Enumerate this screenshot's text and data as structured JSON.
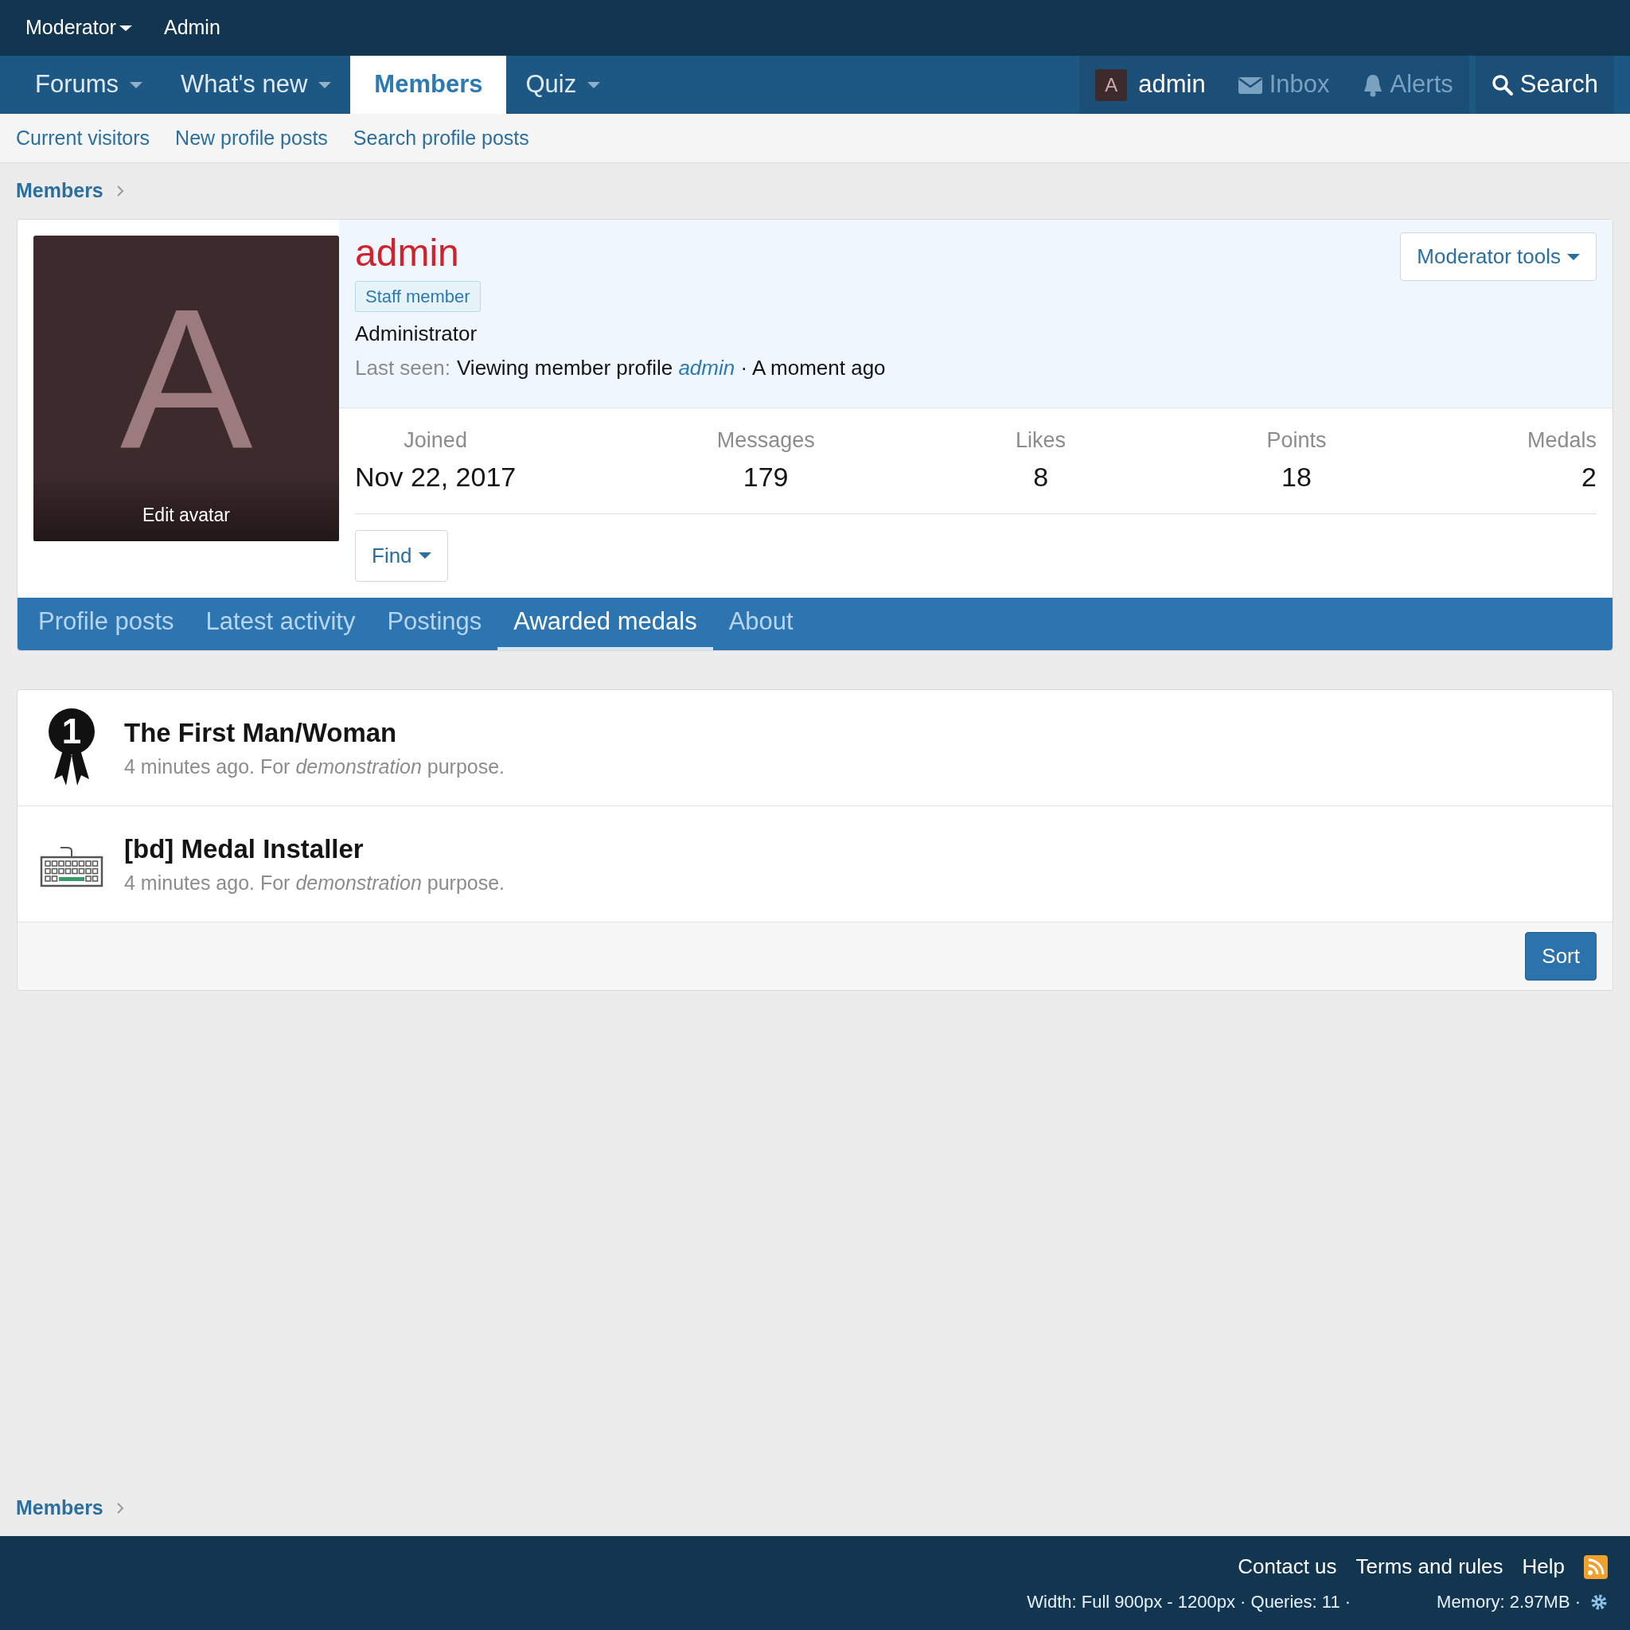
{
  "staff_bar": [
    {
      "label": "Moderator",
      "dropdown": true
    },
    {
      "label": "Admin",
      "dropdown": false
    }
  ],
  "nav_tabs": [
    {
      "label": "Forums",
      "selected": false,
      "dropdown": true
    },
    {
      "label": "What's new",
      "selected": false,
      "dropdown": true
    },
    {
      "label": "Members",
      "selected": true,
      "dropdown": false
    },
    {
      "label": "Quiz",
      "selected": false,
      "dropdown": true
    }
  ],
  "account": {
    "avatar_letter": "A",
    "username": "admin",
    "inbox": "Inbox",
    "alerts": "Alerts",
    "search": "Search"
  },
  "sub_nav": [
    "Current visitors",
    "New profile posts",
    "Search profile posts"
  ],
  "breadcrumb": "Members",
  "profile": {
    "avatar_letter": "A",
    "edit_avatar": "Edit avatar",
    "username": "admin",
    "banner": "Staff member",
    "title": "Administrator",
    "last_seen_label": "Last seen:",
    "last_seen": "Viewing member profile *admin* · A moment ago",
    "moderator_tools": "Moderator tools",
    "stats": [
      {
        "label": "Joined",
        "value": "Nov 22, 2017"
      },
      {
        "label": "Messages",
        "value": "179"
      },
      {
        "label": "Likes",
        "value": "8"
      },
      {
        "label": "Points",
        "value": "18"
      },
      {
        "label": "Medals",
        "value": "2"
      }
    ],
    "find": "Find",
    "tabs": [
      {
        "label": "Profile posts",
        "selected": false
      },
      {
        "label": "Latest activity",
        "selected": false
      },
      {
        "label": "Postings",
        "selected": false
      },
      {
        "label": "Awarded medals",
        "selected": true
      },
      {
        "label": "About",
        "selected": false
      }
    ]
  },
  "medals": [
    {
      "kind": "ribbon",
      "icon_text": "1",
      "name": "The First Man/Woman",
      "detail": "4 minutes ago. For *demonstration* purpose."
    },
    {
      "kind": "keyboard",
      "name": "[bd] Medal Installer",
      "detail": "4 minutes ago. For *demonstration* purpose."
    }
  ],
  "sort_button": "Sort",
  "bottom_breadcrumb": "Members",
  "footer": {
    "links": [
      "Contact us",
      "Terms and rules",
      "Help"
    ],
    "debug": [
      "Width: Full 900px - 1200px · Queries: 11 ·",
      "Memory: 2.97MB ·"
    ]
  }
}
